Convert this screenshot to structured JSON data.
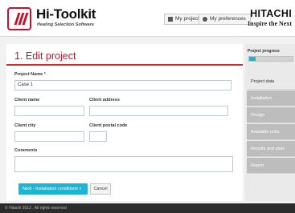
{
  "header": {
    "app_title": "Hi-Toolkit",
    "app_subtitle": "Heating Selection Software",
    "my_projects_label": "My projects",
    "my_preferences_label": "My preferences",
    "brand_name": "HITACHI",
    "brand_tagline": "Inspire the Next"
  },
  "form": {
    "page_title": "1. Edit project",
    "project_name_label": "Project Name",
    "required_mark": "*",
    "project_name_value": "Case 1",
    "client_name_label": "Client name",
    "client_name_value": "",
    "client_address_label": "Client address",
    "client_address_value": "",
    "client_city_label": "Client city",
    "client_city_value": "",
    "client_postal_code_label": "Client postal code",
    "client_postal_code_value": "",
    "comments_label": "Comments",
    "comments_value": "",
    "next_button_label": "Next - Installation conditions »",
    "cancel_button_label": "Cancel"
  },
  "sidebar": {
    "progress_label": "Project progress",
    "progress_fraction": 0.15,
    "items": [
      {
        "label": "Project data",
        "active": true
      },
      {
        "label": "Installation",
        "active": false
      },
      {
        "label": "Design",
        "active": false
      },
      {
        "label": "Available units",
        "active": false
      },
      {
        "label": "Results and plots",
        "active": false
      },
      {
        "label": "Report",
        "active": false
      }
    ]
  },
  "footer": {
    "copyright": "© Hitachi 2012 . All rights reserved"
  },
  "colors": {
    "accent_red": "#c8102e",
    "accent_cyan": "#1ab6d6",
    "sidebar_item": "#bdbdbd",
    "footer_bg": "#2c2c2c"
  }
}
